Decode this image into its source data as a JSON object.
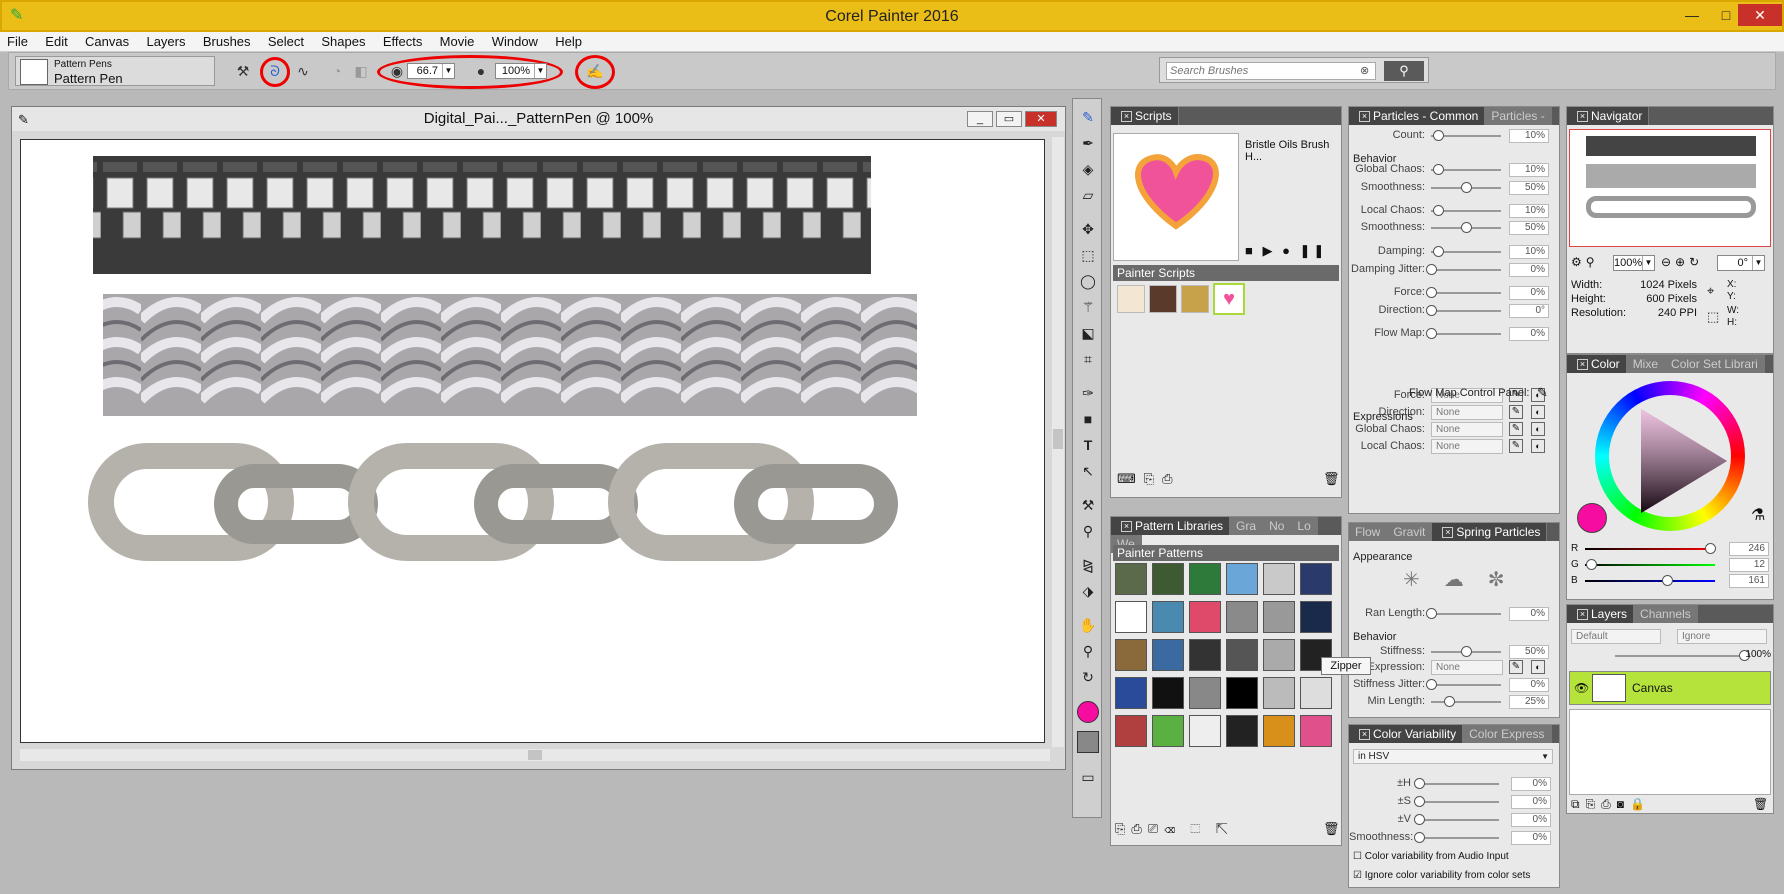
{
  "app": {
    "title": "Corel Painter 2016",
    "minimize": "—",
    "maximize": "□",
    "close": "✕"
  },
  "menu": [
    "File",
    "Edit",
    "Canvas",
    "Layers",
    "Brushes",
    "Select",
    "Shapes",
    "Effects",
    "Movie",
    "Window",
    "Help"
  ],
  "brush_selector": {
    "category": "Pattern Pens",
    "variant": "Pattern Pen"
  },
  "property_bar": {
    "size_value": "66.7",
    "opacity_value": "100%"
  },
  "search": {
    "placeholder": "Search Brushes"
  },
  "document": {
    "title": "Digital_Pai..._PatternPen @ 100%",
    "min": "_",
    "max": "▭",
    "close": "✕"
  },
  "scripts_panel": {
    "tab": "Scripts",
    "script_name": "Bristle Oils Brush H...",
    "sub_header": "Painter Scripts"
  },
  "pattern_libraries": {
    "tabs": [
      "Pattern Libraries",
      "Gra",
      "No",
      "Lo",
      "We"
    ],
    "sub_header": "Painter Patterns",
    "tooltip": "Zipper"
  },
  "particles_common": {
    "tabs": [
      "Particles - Common",
      "Particles -"
    ],
    "count": {
      "label": "Count:",
      "value": "10%",
      "level": 0.1
    },
    "behavior": "Behavior",
    "global_chaos": {
      "label": "Global Chaos:",
      "value": "10%",
      "level": 0.1
    },
    "smoothness1": {
      "label": "Smoothness:",
      "value": "50%",
      "level": 0.5
    },
    "local_chaos": {
      "label": "Local Chaos:",
      "value": "10%",
      "level": 0.1
    },
    "smoothness2": {
      "label": "Smoothness:",
      "value": "50%",
      "level": 0.5
    },
    "damping": {
      "label": "Damping:",
      "value": "10%",
      "level": 0.1
    },
    "damping_jitter": {
      "label": "Damping Jitter:",
      "value": "0%",
      "level": 0
    },
    "force": {
      "label": "Force:",
      "value": "0%",
      "level": 0
    },
    "direction": {
      "label": "Direction:",
      "value": "0°",
      "level": 0
    },
    "flow_map": {
      "label": "Flow Map:",
      "value": "0%",
      "level": 0
    },
    "flow_map_cp": "Flow Map Control Panel:",
    "expressions": "Expressions",
    "exp_rows": [
      {
        "label": "Force:",
        "value": "None"
      },
      {
        "label": "Direction:",
        "value": "None"
      },
      {
        "label": "Global Chaos:",
        "value": "None"
      },
      {
        "label": "Local Chaos:",
        "value": "None"
      }
    ]
  },
  "spring_particles": {
    "tabs": [
      "Flow",
      "Gravit",
      "Spring Particles"
    ],
    "appearance": "Appearance",
    "ran_length": {
      "label": "Ran Length:",
      "value": "0%",
      "level": 0
    },
    "behavior": "Behavior",
    "stiffness": {
      "label": "Stiffness:",
      "value": "50%",
      "level": 0.5
    },
    "expression": {
      "label": "Expression:",
      "value": "None"
    },
    "stiffness_jitter": {
      "label": "Stiffness Jitter:",
      "value": "0%",
      "level": 0
    },
    "min_length": {
      "label": "Min Length:",
      "value": "25%",
      "level": 0.25
    }
  },
  "color_variability": {
    "tabs": [
      "Color Variability",
      "Color Express"
    ],
    "mode": "in HSV",
    "h": {
      "label": "±H",
      "value": "0%"
    },
    "s": {
      "label": "±S",
      "value": "0%"
    },
    "v": {
      "label": "±V",
      "value": "0%"
    },
    "smoothness": {
      "label": "Smoothness:",
      "value": "0%"
    },
    "check1": "Color variability from Audio Input",
    "check2": "Ignore color variability from color sets"
  },
  "navigator": {
    "tab": "Navigator",
    "zoom": "100%",
    "rotation": "0°",
    "width_label": "Width:",
    "width": "1024 Pixels",
    "height_label": "Height:",
    "height": "600 Pixels",
    "res_label": "Resolution:",
    "res": "240 PPI",
    "x": "X:",
    "y": "Y:",
    "w": "W:",
    "h": "H:"
  },
  "color_panel": {
    "tabs": [
      "Color",
      "Mixe",
      "Color Set Librari"
    ],
    "r_label": "R",
    "r": "246",
    "g_label": "G",
    "g": "12",
    "b_label": "B",
    "b": "161",
    "color": "#f60ca1"
  },
  "layers_panel": {
    "tabs": [
      "Layers",
      "Channels"
    ],
    "composite": "Default",
    "ignore": "Ignore",
    "opacity": "100%",
    "layer": "Canvas"
  }
}
